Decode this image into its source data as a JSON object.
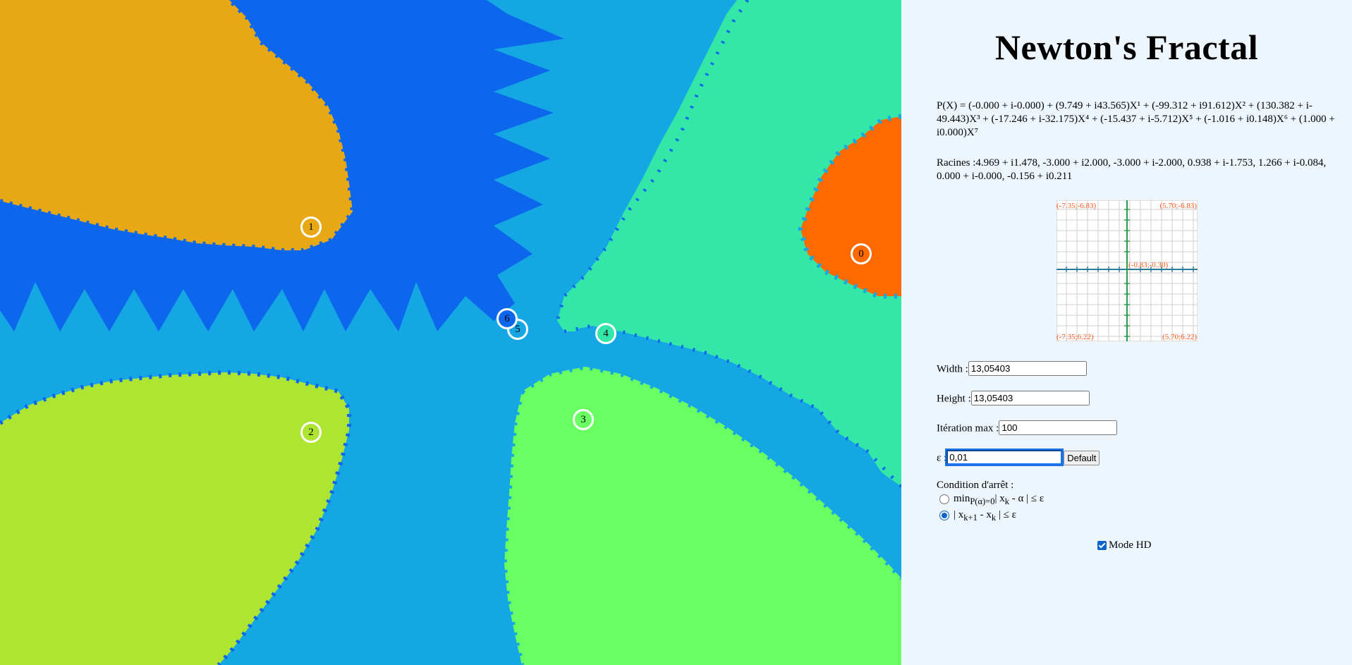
{
  "fractal": {
    "colors": {
      "background": "#15a7e4",
      "dark_blue": "#0d67ec",
      "root_0": "#ff6a00",
      "root_1": "#e8a816",
      "root_2": "#aee432",
      "root_3": "#69fe62",
      "root_4": "#33e7a8",
      "root_5": "#15a7e4",
      "root_6": "#0d67ec",
      "accent_red": "#ff3b00",
      "accent_yellow": "#ffd500"
    },
    "root_markers": [
      {
        "label": "0",
        "color": "#ff6a00"
      },
      {
        "label": "1",
        "color": "#e8a816"
      },
      {
        "label": "2",
        "color": "#aee432"
      },
      {
        "label": "3",
        "color": "#69fe62"
      },
      {
        "label": "4",
        "color": "#33e7a8"
      },
      {
        "label": "5",
        "color": "#15a7e4"
      },
      {
        "label": "6",
        "color": "#0d67ec"
      }
    ]
  },
  "panel": {
    "title": "Newton's Fractal",
    "polynomial_text": "P(X) = (-0.000 + i-0.000) + (9.749 + i43.565)X¹ + (-99.312 + i91.612)X² + (130.382 + i-49.443)X³ + (-17.246 + i-32.175)X⁴ + (-15.437 + i-5.712)X⁵ + (-1.016 + i0.148)X⁶ + (1.000 + i0.000)X⁷",
    "roots_text": "Racines :4.969 + i1.478, -3.000 + i2.000, -3.000 + i-2.000, 0.938 + i-1.753, 1.266 + i-0.084, 0.000 + i-0.000, -0.156 + i0.211",
    "preview": {
      "top_left": "(-7.35;-6.83)",
      "top_right": "(5.70;-6.83)",
      "bottom_left": "(-7.35;6.22)",
      "bottom_right": "(5.70;6.22)",
      "center": "(-0.83;-0.30)",
      "label_color": "#ff5a1f",
      "axis_x_color": "#2a7a9a",
      "axis_y_color": "#2a9a4a",
      "grid_color": "#cfcfcf"
    },
    "width": {
      "label": "Width :",
      "value": "13,05403"
    },
    "height": {
      "label": "Height :",
      "value": "13,05403"
    },
    "iter": {
      "label": "Itération max :",
      "value": "100"
    },
    "eps": {
      "label": "ε :",
      "value": "0,01",
      "default_button": "Default"
    },
    "stop": {
      "label": "Condition d'arrêt :",
      "opt1": {
        "a": "min",
        "sub": "P(α)=0",
        "b": "| x",
        "sub2": "k",
        "c": " - α | ≤ ε"
      },
      "opt2": {
        "a": "| x",
        "sub": "k+1",
        "b": " - x",
        "sub2": "k",
        "c": " | ≤ ε"
      }
    },
    "hd": {
      "label": "Mode HD",
      "checked": true
    }
  }
}
